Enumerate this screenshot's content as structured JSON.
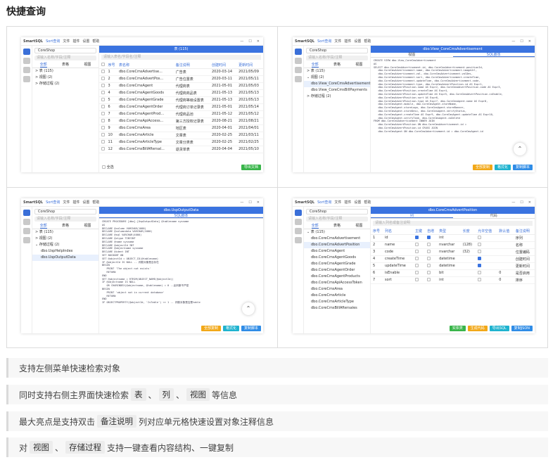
{
  "heading": "快捷查询",
  "app": {
    "name": "SmartSQL",
    "menu": [
      "Sort查询",
      "文件",
      "插件",
      "设置",
      "帮助"
    ],
    "database": "CoreShop",
    "search_placeholder": "请输入名称/字段/注释",
    "side_tabs": [
      "全部",
      "表格",
      "视图"
    ]
  },
  "shot1": {
    "header": "表 (115)",
    "search_placeholder": "请输入表名/字段名/注释",
    "tree": [
      "表 (115)",
      "视图 (2)",
      "存储过程 (2)"
    ],
    "columns": [
      "",
      "序号",
      "表名称",
      "备注说明",
      "创建时间",
      "更新时间"
    ],
    "rows": [
      [
        "1",
        "dbo.CoreCmsAdvertise...",
        "广告表",
        "2020-03-14",
        "2021/05/09"
      ],
      [
        "2",
        "dbo.CoreCmsAdvertPos...",
        "广告位置表",
        "2020-03-11",
        "2021/05/11"
      ],
      [
        "3",
        "dbo.CoreCmsAgent",
        "代理商表",
        "2021-05-01",
        "2021/05/03"
      ],
      [
        "4",
        "dbo.CoreCmsAgentGoods",
        "代理商商品表",
        "2021-05-13",
        "2021/05/13"
      ],
      [
        "5",
        "dbo.CoreCmsAgentGrade",
        "代理商等级设置表",
        "2021-05-13",
        "2021/05/13"
      ],
      [
        "6",
        "dbo.CoreCmsAgentOrder",
        "代理商订单记录表",
        "2021-05-01",
        "2021/05/14"
      ],
      [
        "7",
        "dbo.CoreCmsAgentProd...",
        "代理商品池",
        "2021-05-12",
        "2021/05/12"
      ],
      [
        "8",
        "dbo.CoreCmsApiAccess...",
        "第三方授权记录表",
        "2020-08-21",
        "2021/08/21"
      ],
      [
        "9",
        "dbo.CoreCmsArea",
        "地区表",
        "2020-04-01",
        "2021/04/01"
      ],
      [
        "10",
        "dbo.CoreCmsArticle",
        "文章表",
        "2020-02-25",
        "2021/03/11"
      ],
      [
        "11",
        "dbo.CoreCmsArticleType",
        "文章分类表",
        "2020-02-25",
        "2021/02/25"
      ],
      [
        "12",
        "dbo.CoreCmsBillAftersal...",
        "退货单表",
        "2020-04-04",
        "2021/05/10"
      ]
    ],
    "select_all": "全选",
    "export_btn": "导出文档"
  },
  "shot2": {
    "header": "dbo.View_CoreCmsAdvertisement",
    "tabs": [
      "视图",
      "SQL脚本"
    ],
    "tree": [
      "表 (115)",
      "视图 (2)",
      "dbo.View_CoreCmsAdvertisement",
      "dbo.View_CoreCmsBillPayments",
      "存储过程 (2)"
    ],
    "code": [
      "CREATE VIEW dbo.View_CoreCmsAdvertisement",
      "AS",
      "SELECT dbo.CoreCmsAdvertisement.id, dbo.CoreCmsAdvertisement.positionId,",
      "   dbo.CoreCmsAdvertisement.name, dbo.CoreCmsAdvertisement.imageUrl,",
      "   dbo.CoreCmsAdvertisement.val, dbo.CoreCmsAdvertisement.valDes,",
      "   dbo.CoreCmsAdvertisement.sort, dbo.CoreCmsAdvertisement.createTime,",
      "   dbo.CoreCmsAdvertisement.updateTime, dbo.CoreCmsAdvertisement.code,",
      "   dbo.CoreCmsAdvertisement.type, dbo.CoreCmsAdvertPosition.id AS Expr1,",
      "   dbo.CoreCmsAdvertPosition.name AS Expr2, dbo.CoreCmsAdvertPosition.code AS Expr3,",
      "   dbo.CoreCmsAdvertPosition.createTime AS Expr4,",
      "   dbo.CoreCmsAdvertPosition.updateTime AS Expr5, dbo.CoreCmsAdvertPosition.isEnable,",
      "   dbo.CoreCmsAdvertPosition.sort AS Expr6,",
      "   dbo.CoreCmsAdvertPosition.type AS Expr7, dbo.CoreCmsAgent.name AS Expr8,",
      "   dbo.CoreCmsAgent.mobile, dbo.CoreCmsAgent.storeName,",
      "   dbo.CoreCmsAgent.storeLogo, dbo.CoreCmsAgent.storeBanner,",
      "   dbo.CoreCmsAgent.storeDesc, dbo.CoreCmsAgent.verifyStatus,",
      "   dbo.CoreCmsAgent.createTime AS Expr9, dbo.CoreCmsAgent.updateTime AS Expr10,",
      "   dbo.CoreCmsAgent.verifyTime, dbo.CoreCmsAgent.isDelete",
      "FROM dbo.CoreCmsAdvertisement INNER JOIN",
      "   dbo.CoreCmsAdvertPosition ON dbo.CoreCmsAdvertisement.id =",
      "   dbo.CoreCmsAdvertPosition.id CROSS JOIN",
      "   dbo.CoreCmsAgent ON dbo.CoreCmsAdvertisement.id = dbo.CoreCmsAgent.id"
    ],
    "btns": [
      "全部复制",
      "格式化",
      "复制脚本"
    ]
  },
  "shot3": {
    "header": "dbo.UspOutputData",
    "tabs": [
      "SQL脚本"
    ],
    "tree": [
      "表 (115)",
      "视图 (2)",
      "存储过程 (2)",
      "dbo.UspHelpIndex",
      "dbo.UspOutputData"
    ],
    "code": [
      "CREATE PROCEDURE [dbo].[UspOutputData] @tablename sysname",
      "AS",
      "DECLARE @column VARCHAR(1000)",
      "DECLARE @columndata VARCHAR(1000)",
      "DECLARE @sql VARCHAR(4000)",
      "DECLARE @xtype TINYINT",
      "DECLARE @name sysname",
      "DECLARE @objectId INT",
      "DECLARE @objectname sysname",
      "DECLARE @ident INT",
      "",
      "SET NOCOUNT ON",
      "SET @objectId = OBJECT_ID(@tablename)",
      "",
      "IF @objectId IS NULL -- 判断对象是否存在",
      "BEGIN",
      "   PRINT 'The object not exists'",
      "   RETURN",
      "END",
      "SET @objectname = RTRIM(OBJECT_NAME(@objectId))",
      "",
      "IF @objectname IS NULL",
      "   OR CHARINDEX(@objectname, @tablename) = 0 --此判断不严密",
      "BEGIN",
      "   PRINT 'object not in current database'",
      "   RETURN",
      "END",
      "",
      "IF OBJECTPROPERTY(@objectId, 'IsTable') <> 1 -- 判断对象是否是table"
    ],
    "btns": [
      "全部复制",
      "格式化",
      "复制脚本"
    ]
  },
  "shot4": {
    "header": "dbo.CoreCmsAdvertPosition",
    "tabs": [
      "列",
      "代码"
    ],
    "search_placeholder": "请输入列名或备注说明",
    "tree_root": "表 (115)",
    "tree": [
      "dbo.CoreCmsAdvertisement",
      "dbo.CoreCmsAdvertPosition",
      "dbo.CoreCmsAgent",
      "dbo.CoreCmsAgentGoods",
      "dbo.CoreCmsAgentGrade",
      "dbo.CoreCmsAgentOrder",
      "dbo.CoreCmsAgentProducts",
      "dbo.CoreCmsApiAccessToken",
      "dbo.CoreCmsArea",
      "dbo.CoreCmsArticle",
      "dbo.CoreCmsArticleType",
      "dbo.CoreCmsBillAftersales"
    ],
    "columns": [
      "序号",
      "列名",
      "主键",
      "自增",
      "类型",
      "长度",
      "允许空值",
      "默认值",
      "备注说明"
    ],
    "rows": [
      [
        "1",
        "id",
        true,
        true,
        "int",
        "",
        false,
        "",
        "序列"
      ],
      [
        "2",
        "name",
        false,
        false,
        "nvarchar",
        "(128)",
        false,
        "",
        "名称"
      ],
      [
        "3",
        "code",
        false,
        false,
        "nvarchar",
        "(32)",
        false,
        "",
        "位置编码"
      ],
      [
        "4",
        "createTime",
        false,
        false,
        "datetime",
        "",
        true,
        "",
        "创建时间"
      ],
      [
        "5",
        "updateTime",
        false,
        false,
        "datetime",
        "",
        true,
        "",
        "更新时间"
      ],
      [
        "6",
        "isEnable",
        false,
        false,
        "bit",
        "",
        false,
        "0",
        "是否启用"
      ],
      [
        "7",
        "sort",
        false,
        false,
        "int",
        "",
        false,
        "0",
        "排序"
      ]
    ],
    "btns": [
      "实体类",
      "生成代码",
      "导出SQL",
      "复制JSON"
    ]
  },
  "features": [
    {
      "parts": [
        "支持左侧菜单快速检索对象"
      ],
      "tags": []
    },
    {
      "parts": [
        "同时支持右侧主界面快速检索",
        "、",
        "、",
        "等信息"
      ],
      "tags": [
        "表",
        "列",
        "视图"
      ]
    },
    {
      "parts": [
        "最大亮点是支持双击",
        "列对应单元格快速设置对象注释信息"
      ],
      "tags": [
        "备注说明"
      ]
    },
    {
      "parts": [
        "对",
        "、",
        "支持一键查看内容结构、一键复制"
      ],
      "tags": [
        "视图",
        "存储过程"
      ]
    }
  ]
}
